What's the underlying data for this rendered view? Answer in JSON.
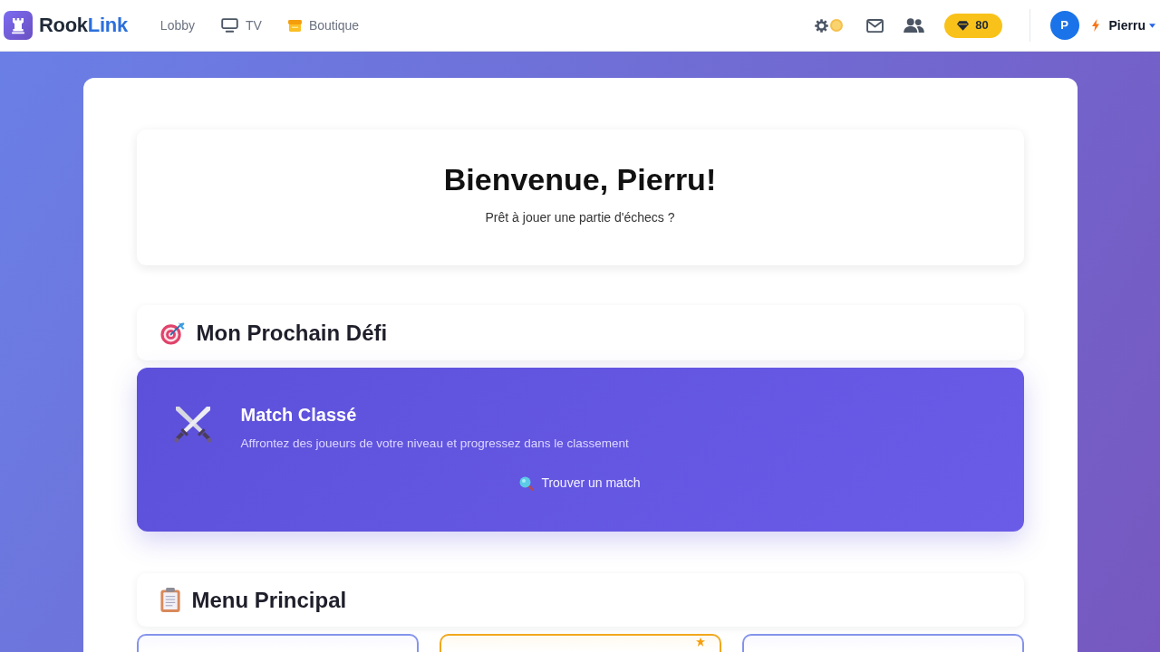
{
  "header": {
    "brand": {
      "parts": [
        "Rook",
        "Link"
      ]
    },
    "nav": [
      {
        "label": "Lobby",
        "kind": "plain"
      },
      {
        "label": "TV",
        "kind": "tv"
      },
      {
        "label": "Boutique",
        "kind": "shop"
      }
    ],
    "coins": "80",
    "user": {
      "initial": "P",
      "name": "Pierru"
    }
  },
  "welcome": {
    "title": "Bienvenue, Pierru!",
    "subtitle": "Prêt à jouer une partie d'échecs ?"
  },
  "next_challenge": {
    "heading": "Mon Prochain Défi",
    "card": {
      "title": "Match Classé",
      "description": "Affrontez des joueurs de votre niveau et progressez dans le classement",
      "button": "Trouver un match"
    }
  },
  "main_menu": {
    "heading": "Menu Principal",
    "cards": [
      {
        "highlighted": false
      },
      {
        "highlighted": true
      },
      {
        "highlighted": false
      }
    ]
  }
}
